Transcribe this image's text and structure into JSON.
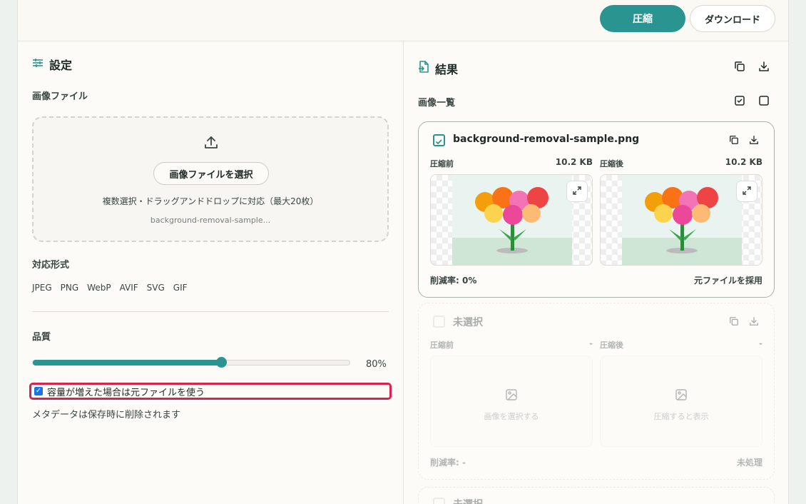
{
  "toolbar": {
    "compress_label": "圧縮",
    "download_label": "ダウンロード"
  },
  "settings": {
    "title": "設定",
    "image_file_label": "画像ファイル",
    "dropzone": {
      "pick_button": "画像ファイルを選択",
      "hint": "複数選択・ドラッグアンドドロップに対応（最大20枚）",
      "selected_file": "background-removal-sample..."
    },
    "formats_label": "対応形式",
    "formats": [
      "JPEG",
      "PNG",
      "WebP",
      "AVIF",
      "SVG",
      "GIF"
    ],
    "quality_label": "品質",
    "quality_value": 80,
    "quality_text": "80%",
    "fallback_checkbox": {
      "label": "容量が増えた場合は元ファイルを使う",
      "checked": true
    },
    "metadata_note": "メタデータは保存時に削除されます"
  },
  "results": {
    "title": "結果",
    "image_list_label": "画像一覧",
    "cards": [
      {
        "filename": "background-removal-sample.png",
        "before_label": "圧縮前",
        "before_size": "10.2 KB",
        "after_label": "圧縮後",
        "after_size": "10.2 KB",
        "reduction": "削減率: 0%",
        "status": "元ファイルを採用"
      },
      {
        "filename": "未選択",
        "before_label": "圧縮前",
        "before_size": "-",
        "after_label": "圧縮後",
        "after_size": "-",
        "before_placeholder": "画像を選択する",
        "after_placeholder": "圧縮すると表示",
        "reduction": "削減率: -",
        "status": "未処理"
      },
      {
        "filename": "未選択"
      }
    ]
  },
  "colors": {
    "accent": "#2a9590",
    "highlight": "#d6234f"
  }
}
